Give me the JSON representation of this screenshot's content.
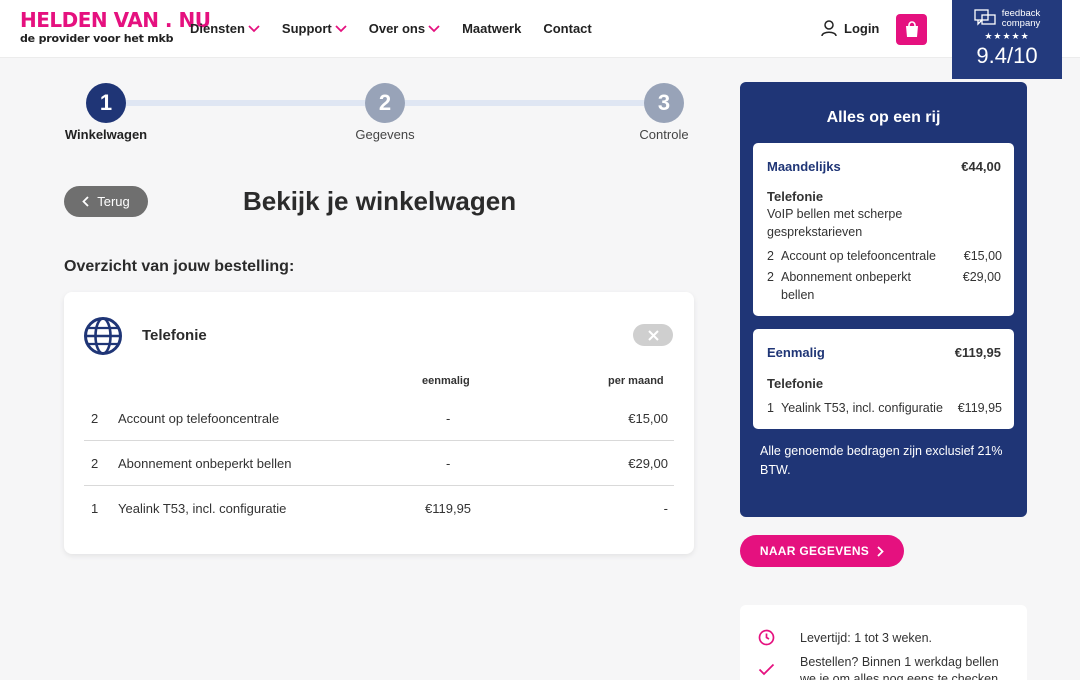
{
  "header": {
    "logo_main": "HELDEN VAN . NU",
    "logo_sub": "de provider voor het mkb",
    "nav": [
      "Diensten",
      "Support",
      "Over ons",
      "Maatwerk",
      "Contact"
    ],
    "login": "Login",
    "feedback": {
      "line1": "feedback",
      "line2": "company",
      "stars": "★★★★★",
      "score": "9.4/10"
    }
  },
  "stepper": {
    "steps": [
      {
        "num": "1",
        "label": "Winkelwagen"
      },
      {
        "num": "2",
        "label": "Gegevens"
      },
      {
        "num": "3",
        "label": "Controle"
      }
    ]
  },
  "main": {
    "back": "Terug",
    "title": "Bekijk je winkelwagen",
    "overview": "Overzicht van jouw bestelling:",
    "product": {
      "name": "Telefonie",
      "col_once": "eenmalig",
      "col_month": "per maand",
      "rows": [
        {
          "qty": "2",
          "name": "Account op telefooncentrale",
          "once": "-",
          "month": "€15,00"
        },
        {
          "qty": "2",
          "name": "Abonnement onbeperkt bellen",
          "once": "-",
          "month": "€29,00"
        },
        {
          "qty": "1",
          "name": "Yealink T53, incl. configuratie",
          "once": "€119,95",
          "month": "-"
        }
      ]
    }
  },
  "summary": {
    "title": "Alles op een rij",
    "monthly": {
      "label": "Maandelijks",
      "amount": "€44,00",
      "section": "Telefonie",
      "desc": "VoIP bellen met scherpe gesprekstarieven",
      "lines": [
        {
          "qty": "2",
          "name": "Account op telefooncentrale",
          "price": "€15,00"
        },
        {
          "qty": "2",
          "name": "Abonnement onbeperkt bellen",
          "price": "€29,00"
        }
      ]
    },
    "once": {
      "label": "Eenmalig",
      "amount": "€119,95",
      "section": "Telefonie",
      "lines": [
        {
          "qty": "1",
          "name": "Yealink T53, incl. configuratie",
          "price": "€119,95"
        }
      ]
    },
    "note": "Alle genoemde bedragen zijn exclusief 21% BTW."
  },
  "cta": "NAAR GEGEVENS",
  "info": {
    "delivery": "Levertijd: 1 tot 3 weken.",
    "order": "Bestellen? Binnen 1 werkdag bellen we je om alles nog eens te checken"
  },
  "colors": {
    "brand_pink": "#e5117f",
    "brand_navy": "#1f3576"
  }
}
